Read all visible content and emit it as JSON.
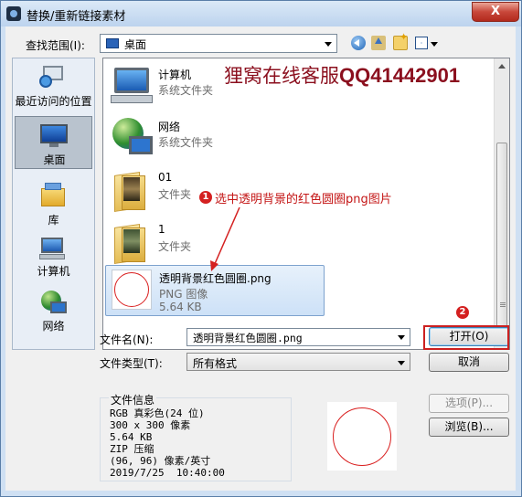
{
  "window": {
    "title": "替换/重新链接素材",
    "close_label": "X"
  },
  "lookin": {
    "label": "查找范围(I):",
    "value": "桌面"
  },
  "toolbar": {
    "icons": [
      "back-icon",
      "up-folder-icon",
      "new-folder-icon",
      "view-menu-icon"
    ]
  },
  "places": [
    {
      "label": "最近访问的位置",
      "icon": "recent-places-icon"
    },
    {
      "label": "桌面",
      "icon": "desktop-icon",
      "selected": true
    },
    {
      "label": "库",
      "icon": "libraries-icon"
    },
    {
      "label": "计算机",
      "icon": "computer-icon"
    },
    {
      "label": "网络",
      "icon": "network-icon"
    }
  ],
  "files": [
    {
      "name": "计算机",
      "type": "系统文件夹",
      "icon": "computer-icon"
    },
    {
      "name": "网络",
      "type": "系统文件夹",
      "icon": "network-icon"
    },
    {
      "name": "01",
      "type": "文件夹",
      "icon": "folder-icon"
    },
    {
      "name": "1",
      "type": "文件夹",
      "icon": "folder-icon"
    },
    {
      "name": "透明背景红色圆圈.png",
      "type": "PNG 图像",
      "size": "5.64 KB",
      "icon": "png-thumbnail",
      "selected": true
    }
  ],
  "watermark": {
    "text_cn": "狸窝在线客服",
    "text_qq": "QQ41442901"
  },
  "annotation": {
    "step1_badge": "1",
    "step1_text": "选中透明背景的红色圆圈png图片",
    "step2_badge": "2"
  },
  "filename": {
    "label": "文件名(N):",
    "value": "透明背景红色圆圈.png"
  },
  "filetype": {
    "label": "文件类型(T):",
    "value": "所有格式"
  },
  "buttons": {
    "open": "打开(O)",
    "cancel": "取消",
    "options": "选项(P)...",
    "browse": "浏览(B)..."
  },
  "fileinfo": {
    "title": "文件信息",
    "lines": [
      "RGB 真彩色(24 位)",
      "300 x 300 像素",
      "5.64 KB",
      "ZIP 压缩",
      "(96, 96) 像素/英寸",
      "2019/7/25  10:40:00"
    ]
  },
  "colors": {
    "accent_red": "#d42020",
    "selection_blue": "#cde1f7",
    "watermark": "#8b0f1e"
  }
}
